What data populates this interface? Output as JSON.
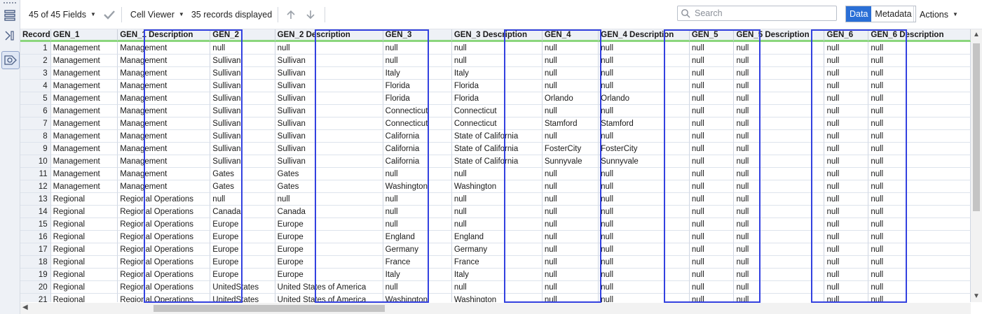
{
  "toolbar": {
    "fields_label": "45 of 45 Fields",
    "viewer_label": "Cell Viewer",
    "records_label": "35 records displayed",
    "search_placeholder": "Search",
    "data_tab": "Data",
    "metadata_tab": "Metadata",
    "actions_label": "Actions"
  },
  "table": {
    "columns": [
      "Record",
      "GEN_1",
      "GEN_1 Description",
      "GEN_2",
      "GEN_2 Description",
      "GEN_3",
      "GEN_3 Description",
      "GEN_4",
      "GEN_4 Description",
      "GEN_5",
      "GEN_5 Description",
      "GEN_6",
      "GEN_6 Description"
    ],
    "rows": [
      [
        "1",
        "Management",
        "Management",
        "null",
        "null",
        "null",
        "null",
        "null",
        "null",
        "null",
        "null",
        "null",
        "null"
      ],
      [
        "2",
        "Management",
        "Management",
        "Sullivan",
        "Sullivan",
        "null",
        "null",
        "null",
        "null",
        "null",
        "null",
        "null",
        "null"
      ],
      [
        "3",
        "Management",
        "Management",
        "Sullivan",
        "Sullivan",
        "Italy",
        "Italy",
        "null",
        "null",
        "null",
        "null",
        "null",
        "null"
      ],
      [
        "4",
        "Management",
        "Management",
        "Sullivan",
        "Sullivan",
        "Florida",
        "Florida",
        "null",
        "null",
        "null",
        "null",
        "null",
        "null"
      ],
      [
        "5",
        "Management",
        "Management",
        "Sullivan",
        "Sullivan",
        "Florida",
        "Florida",
        "Orlando",
        "Orlando",
        "null",
        "null",
        "null",
        "null"
      ],
      [
        "6",
        "Management",
        "Management",
        "Sullivan",
        "Sullivan",
        "Connecticut",
        "Connecticut",
        "null",
        "null",
        "null",
        "null",
        "null",
        "null"
      ],
      [
        "7",
        "Management",
        "Management",
        "Sullivan",
        "Sullivan",
        "Connecticut",
        "Connecticut",
        "Stamford",
        "Stamford",
        "null",
        "null",
        "null",
        "null"
      ],
      [
        "8",
        "Management",
        "Management",
        "Sullivan",
        "Sullivan",
        "California",
        "State of California",
        "null",
        "null",
        "null",
        "null",
        "null",
        "null"
      ],
      [
        "9",
        "Management",
        "Management",
        "Sullivan",
        "Sullivan",
        "California",
        "State of California",
        "FosterCity",
        "FosterCity",
        "null",
        "null",
        "null",
        "null"
      ],
      [
        "10",
        "Management",
        "Management",
        "Sullivan",
        "Sullivan",
        "California",
        "State of California",
        "Sunnyvale",
        "Sunnyvale",
        "null",
        "null",
        "null",
        "null"
      ],
      [
        "11",
        "Management",
        "Management",
        "Gates",
        "Gates",
        "null",
        "null",
        "null",
        "null",
        "null",
        "null",
        "null",
        "null"
      ],
      [
        "12",
        "Management",
        "Management",
        "Gates",
        "Gates",
        "Washington",
        "Washington",
        "null",
        "null",
        "null",
        "null",
        "null",
        "null"
      ],
      [
        "13",
        "Regional",
        "Regional Operations",
        "null",
        "null",
        "null",
        "null",
        "null",
        "null",
        "null",
        "null",
        "null",
        "null"
      ],
      [
        "14",
        "Regional",
        "Regional Operations",
        "Canada",
        "Canada",
        "null",
        "null",
        "null",
        "null",
        "null",
        "null",
        "null",
        "null"
      ],
      [
        "15",
        "Regional",
        "Regional Operations",
        "Europe",
        "Europe",
        "null",
        "null",
        "null",
        "null",
        "null",
        "null",
        "null",
        "null"
      ],
      [
        "16",
        "Regional",
        "Regional Operations",
        "Europe",
        "Europe",
        "England",
        "England",
        "null",
        "null",
        "null",
        "null",
        "null",
        "null"
      ],
      [
        "17",
        "Regional",
        "Regional Operations",
        "Europe",
        "Europe",
        "Germany",
        "Germany",
        "null",
        "null",
        "null",
        "null",
        "null",
        "null"
      ],
      [
        "18",
        "Regional",
        "Regional Operations",
        "Europe",
        "Europe",
        "France",
        "France",
        "null",
        "null",
        "null",
        "null",
        "null",
        "null"
      ],
      [
        "19",
        "Regional",
        "Regional Operations",
        "Europe",
        "Europe",
        "Italy",
        "Italy",
        "null",
        "null",
        "null",
        "null",
        "null",
        "null"
      ],
      [
        "20",
        "Regional",
        "Regional Operations",
        "UnitedStates",
        "United States of America",
        "null",
        "null",
        "null",
        "null",
        "null",
        "null",
        "null",
        "null"
      ],
      [
        "21",
        "Regional",
        "Regional Operations",
        "UnitedStates",
        "United States of America",
        "Washington",
        "Washington",
        "null",
        "null",
        "null",
        "null",
        "null",
        "null"
      ]
    ]
  },
  "colors": {
    "accent": "#2a6fd6",
    "highlight": "#3341e0",
    "header_underline": "#8bd67d"
  }
}
